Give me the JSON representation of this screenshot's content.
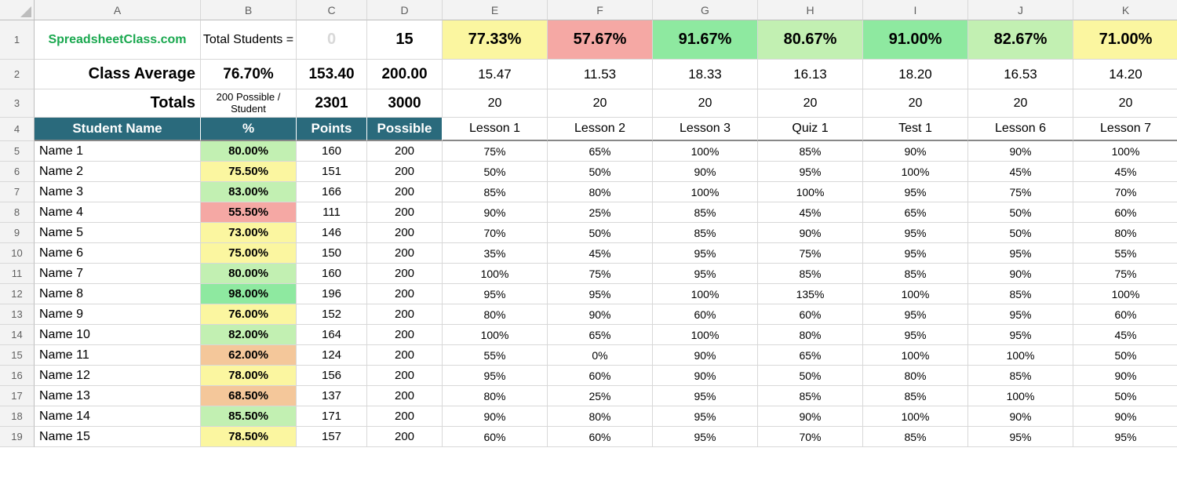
{
  "columns": [
    "A",
    "B",
    "C",
    "D",
    "E",
    "F",
    "G",
    "H",
    "I",
    "J",
    "K"
  ],
  "row_numbers": [
    1,
    2,
    3,
    4,
    5,
    6,
    7,
    8,
    9,
    10,
    11,
    12,
    13,
    14,
    15,
    16,
    17,
    18,
    19
  ],
  "row1": {
    "A": "SpreadsheetClass.com",
    "B": "Total Students =",
    "C": "0",
    "D": "15",
    "percents": [
      "77.33%",
      "57.67%",
      "91.67%",
      "80.67%",
      "91.00%",
      "82.67%",
      "71.00%"
    ],
    "percent_classes": [
      "cf-yellow",
      "cf-red",
      "cf-green",
      "cf-lgreen",
      "cf-green",
      "cf-lgreen",
      "cf-yellow"
    ]
  },
  "row2": {
    "label": "Class Average",
    "B": "76.70%",
    "C": "153.40",
    "D": "200.00",
    "vals": [
      "15.47",
      "11.53",
      "18.33",
      "16.13",
      "18.20",
      "16.53",
      "14.20"
    ]
  },
  "row3": {
    "label": "Totals",
    "B": "200 Possible / Student",
    "C": "2301",
    "D": "3000",
    "vals": [
      "20",
      "20",
      "20",
      "20",
      "20",
      "20",
      "20"
    ]
  },
  "row4": {
    "A": "Student Name",
    "B": "%",
    "C": "Points",
    "D": "Possible",
    "headers": [
      "Lesson 1",
      "Lesson 2",
      "Lesson 3",
      "Quiz 1",
      "Test 1",
      "Lesson 6",
      "Lesson 7"
    ]
  },
  "students": [
    {
      "name": "Name 1",
      "pct": "80.00%",
      "cls": "cf-lgreen",
      "pts": "160",
      "poss": "200",
      "s": [
        "75%",
        "65%",
        "100%",
        "85%",
        "90%",
        "90%",
        "100%"
      ]
    },
    {
      "name": "Name 2",
      "pct": "75.50%",
      "cls": "cf-yellow",
      "pts": "151",
      "poss": "200",
      "s": [
        "50%",
        "50%",
        "90%",
        "95%",
        "100%",
        "45%",
        "45%"
      ]
    },
    {
      "name": "Name 3",
      "pct": "83.00%",
      "cls": "cf-lgreen",
      "pts": "166",
      "poss": "200",
      "s": [
        "85%",
        "80%",
        "100%",
        "100%",
        "95%",
        "75%",
        "70%"
      ]
    },
    {
      "name": "Name 4",
      "pct": "55.50%",
      "cls": "cf-red",
      "pts": "111",
      "poss": "200",
      "s": [
        "90%",
        "25%",
        "85%",
        "45%",
        "65%",
        "50%",
        "60%"
      ]
    },
    {
      "name": "Name 5",
      "pct": "73.00%",
      "cls": "cf-yellow",
      "pts": "146",
      "poss": "200",
      "s": [
        "70%",
        "50%",
        "85%",
        "90%",
        "95%",
        "50%",
        "80%"
      ]
    },
    {
      "name": "Name 6",
      "pct": "75.00%",
      "cls": "cf-yellow",
      "pts": "150",
      "poss": "200",
      "s": [
        "35%",
        "45%",
        "95%",
        "75%",
        "95%",
        "95%",
        "55%"
      ]
    },
    {
      "name": "Name 7",
      "pct": "80.00%",
      "cls": "cf-lgreen",
      "pts": "160",
      "poss": "200",
      "s": [
        "100%",
        "75%",
        "95%",
        "85%",
        "85%",
        "90%",
        "75%"
      ]
    },
    {
      "name": "Name 8",
      "pct": "98.00%",
      "cls": "cf-green",
      "pts": "196",
      "poss": "200",
      "s": [
        "95%",
        "95%",
        "100%",
        "135%",
        "100%",
        "85%",
        "100%"
      ]
    },
    {
      "name": "Name 9",
      "pct": "76.00%",
      "cls": "cf-yellow",
      "pts": "152",
      "poss": "200",
      "s": [
        "80%",
        "90%",
        "60%",
        "60%",
        "95%",
        "95%",
        "60%"
      ]
    },
    {
      "name": "Name 10",
      "pct": "82.00%",
      "cls": "cf-lgreen",
      "pts": "164",
      "poss": "200",
      "s": [
        "100%",
        "65%",
        "100%",
        "80%",
        "95%",
        "95%",
        "45%"
      ]
    },
    {
      "name": "Name 11",
      "pct": "62.00%",
      "cls": "cf-orange",
      "pts": "124",
      "poss": "200",
      "s": [
        "55%",
        "0%",
        "90%",
        "65%",
        "100%",
        "100%",
        "50%"
      ]
    },
    {
      "name": "Name 12",
      "pct": "78.00%",
      "cls": "cf-yellow",
      "pts": "156",
      "poss": "200",
      "s": [
        "95%",
        "60%",
        "90%",
        "50%",
        "80%",
        "85%",
        "90%"
      ]
    },
    {
      "name": "Name 13",
      "pct": "68.50%",
      "cls": "cf-orange",
      "pts": "137",
      "poss": "200",
      "s": [
        "80%",
        "25%",
        "95%",
        "85%",
        "85%",
        "100%",
        "50%"
      ]
    },
    {
      "name": "Name 14",
      "pct": "85.50%",
      "cls": "cf-lgreen",
      "pts": "171",
      "poss": "200",
      "s": [
        "90%",
        "80%",
        "95%",
        "90%",
        "100%",
        "90%",
        "90%"
      ]
    },
    {
      "name": "Name 15",
      "pct": "78.50%",
      "cls": "cf-yellow",
      "pts": "157",
      "poss": "200",
      "s": [
        "60%",
        "60%",
        "95%",
        "70%",
        "85%",
        "95%",
        "95%"
      ]
    }
  ]
}
